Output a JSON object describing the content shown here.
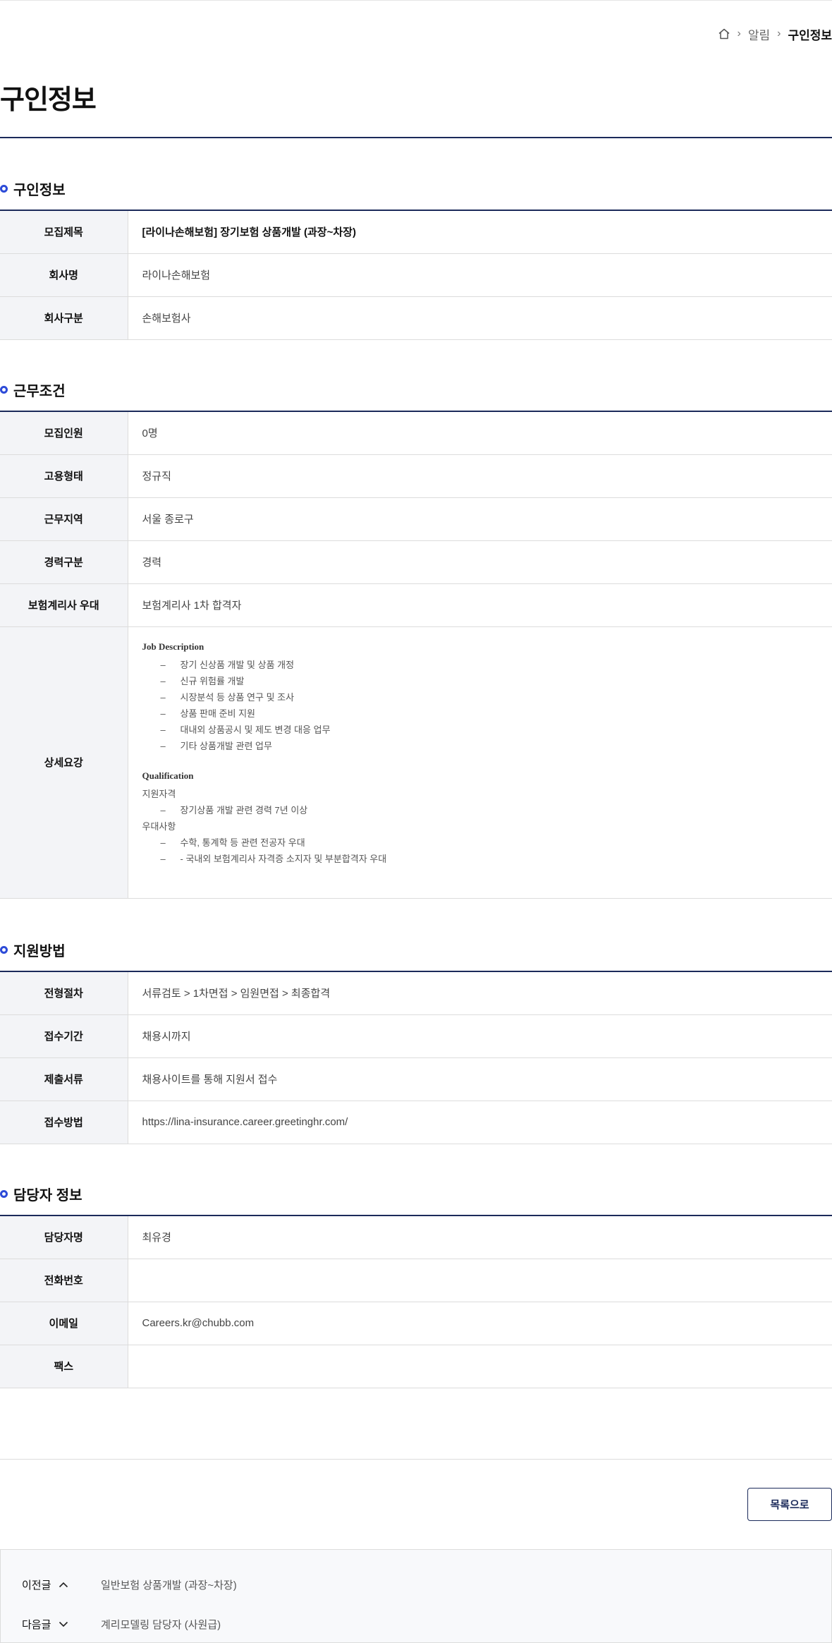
{
  "breadcrumb": {
    "items": [
      "알림",
      "구인정보"
    ]
  },
  "page_title": "구인정보",
  "sections": {
    "job": {
      "title": "구인정보",
      "rows": [
        {
          "label": "모집제목",
          "value": "[라이나손해보험] 장기보험 상품개발 (과장~차장)"
        },
        {
          "label": "회사명",
          "value": "라이나손해보험"
        },
        {
          "label": "회사구분",
          "value": "손해보험사"
        }
      ]
    },
    "work": {
      "title": "근무조건",
      "rows": [
        {
          "label": "모집인원",
          "value": "0명"
        },
        {
          "label": "고용형태",
          "value": "정규직"
        },
        {
          "label": "근무지역",
          "value": "서울 종로구"
        },
        {
          "label": "경력구분",
          "value": "경력"
        },
        {
          "label": "보험계리사 우대",
          "value": "보험계리사 1차 합격자"
        }
      ],
      "detail_label": "상세요강",
      "detail": {
        "jd_heading": "Job Description",
        "jd_items": [
          "장기 신상품 개발 및 상품 개정",
          "신규 위험률 개발",
          "시장분석 등 상품 연구 및 조사",
          "상품 판매 준비 지원",
          "대내외 상품공시 및 제도 변경 대응 업무",
          "기타 상품개발 관련 업무"
        ],
        "q_heading": "Qualification",
        "req_label": "지원자격",
        "req_items": [
          "장기상품 개발 관련 경력 7년 이상"
        ],
        "pref_label": "우대사항",
        "pref_items": [
          "수학, 통계학 등 관련 전공자 우대",
          "- 국내외 보험계리사 자격증 소지자 및 부분합격자 우대"
        ],
        "dash": "–"
      }
    },
    "apply": {
      "title": "지원방법",
      "rows": [
        {
          "label": "전형절차",
          "value": "서류검토 > 1차면접 > 임원면접 > 최종합격"
        },
        {
          "label": "접수기간",
          "value": "채용시까지"
        },
        {
          "label": "제출서류",
          "value": "채용사이트를 통해 지원서 접수"
        },
        {
          "label": "접수방법",
          "value": "https://lina-insurance.career.greetinghr.com/"
        }
      ]
    },
    "contact": {
      "title": "담당자 정보",
      "rows": [
        {
          "label": "담당자명",
          "value": "최유경"
        },
        {
          "label": "전화번호",
          "value": ""
        },
        {
          "label": "이메일",
          "value": "Careers.kr@chubb.com"
        },
        {
          "label": "팩스",
          "value": ""
        }
      ]
    }
  },
  "list_button": "목록으로",
  "nav": {
    "prev_label": "이전글",
    "prev_title": "일반보험 상품개발 (과장~차장)",
    "next_label": "다음글",
    "next_title": "계리모델링 담당자 (사원급)"
  },
  "colors": {
    "accent": "#2d4bd8",
    "navy": "#1b2a5a"
  }
}
